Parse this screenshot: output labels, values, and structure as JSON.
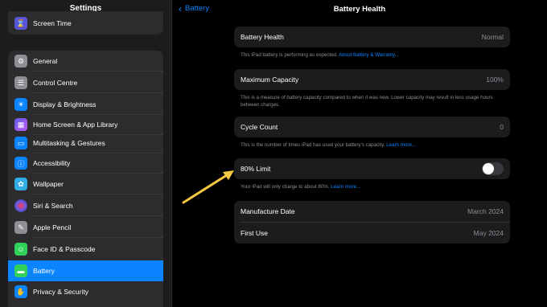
{
  "sidebar": {
    "title": "Settings",
    "top_item": {
      "label": "Screen Time",
      "icon": "hourglass-icon",
      "color": "#5856d6"
    },
    "items": [
      {
        "label": "General",
        "icon": "gear-icon",
        "color": "#8e8e93"
      },
      {
        "label": "Control Centre",
        "icon": "sliders-icon",
        "color": "#8e8e93"
      },
      {
        "label": "Display & Brightness",
        "icon": "sun-icon",
        "color": "#0a84ff"
      },
      {
        "label": "Home Screen & App Library",
        "icon": "grid-icon",
        "color": "#5e5ce6"
      },
      {
        "label": "Multitasking & Gestures",
        "icon": "multitask-icon",
        "color": "#0a84ff"
      },
      {
        "label": "Accessibility",
        "icon": "accessibility-icon",
        "color": "#0a84ff"
      },
      {
        "label": "Wallpaper",
        "icon": "flower-icon",
        "color": "#32ade6"
      },
      {
        "label": "Siri & Search",
        "icon": "siri-icon",
        "color": "#1c1c1e"
      },
      {
        "label": "Apple Pencil",
        "icon": "pencil-icon",
        "color": "#8e8e93"
      },
      {
        "label": "Face ID & Passcode",
        "icon": "faceid-icon",
        "color": "#30d158"
      },
      {
        "label": "Battery",
        "icon": "battery-icon",
        "color": "#30d158",
        "active": true
      },
      {
        "label": "Privacy & Security",
        "icon": "hand-icon",
        "color": "#0a84ff"
      }
    ]
  },
  "header": {
    "back_label": "Battery",
    "title": "Battery Health"
  },
  "battery_health": {
    "label": "Battery Health",
    "value": "Normal",
    "note": "This iPad battery is performing as expected.",
    "note_link": "About Battery & Warranty..."
  },
  "max_capacity": {
    "label": "Maximum Capacity",
    "value": "100%",
    "note": "This is a measure of battery capacity compared to when it was new. Lower capacity may result in less usage hours between charges."
  },
  "cycle_count": {
    "label": "Cycle Count",
    "value": "0",
    "note": "This is the number of times iPad has used your battery's capacity.",
    "note_link": "Learn more..."
  },
  "limit": {
    "label": "80% Limit",
    "enabled": false,
    "note": "Your iPad will only charge to about 80%.",
    "note_link": "Learn more..."
  },
  "dates": {
    "manufacture_label": "Manufacture Date",
    "manufacture_value": "March 2024",
    "first_use_label": "First Use",
    "first_use_value": "May 2024"
  },
  "colors": {
    "accent": "#0a84ff",
    "annotation_arrow": "#f5c842"
  }
}
